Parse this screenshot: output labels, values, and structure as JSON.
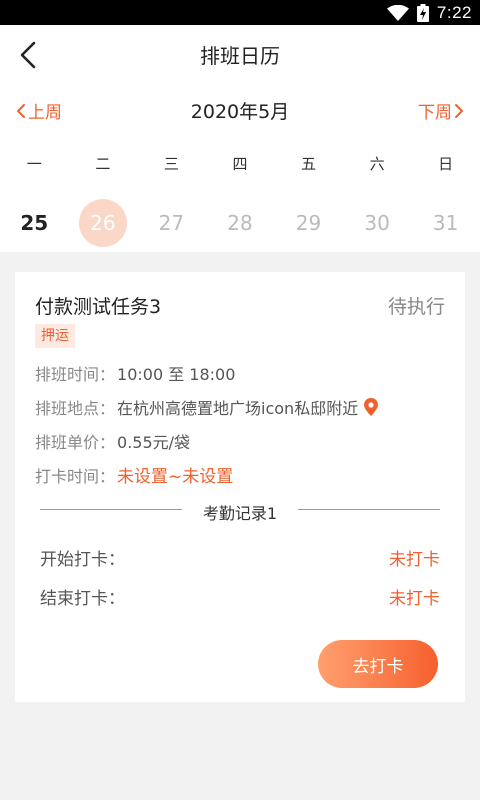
{
  "status_bar": {
    "time": "7:22"
  },
  "header": {
    "title": "排班日历"
  },
  "calendar": {
    "prev_label": "上周",
    "next_label": "下周",
    "month": "2020年5月",
    "weekdays": [
      "一",
      "二",
      "三",
      "四",
      "五",
      "六",
      "日"
    ],
    "dates": [
      "25",
      "26",
      "27",
      "28",
      "29",
      "30",
      "31"
    ],
    "today_index": 0,
    "selected_index": 1
  },
  "card": {
    "title": "付款测试任务3",
    "status": "待执行",
    "tag": "押运",
    "time_label": "排班时间：",
    "time_value": "10:00 至 18:00",
    "location_label": "排班地点：",
    "location_value": "在杭州高德置地广场icon私邸附近",
    "price_label": "排班单价：",
    "price_value": "0.55元/袋",
    "clock_label": "打卡时间：",
    "clock_value": "未设置~未设置",
    "record_title": "考勤记录1",
    "start_label": "开始打卡：",
    "start_value": "未打卡",
    "end_label": "结束打卡：",
    "end_value": "未打卡",
    "go_button": "去打卡"
  },
  "colors": {
    "accent": "#f0602f",
    "selected_circle": "#fbd7c7",
    "background": "#f2f2f2"
  }
}
